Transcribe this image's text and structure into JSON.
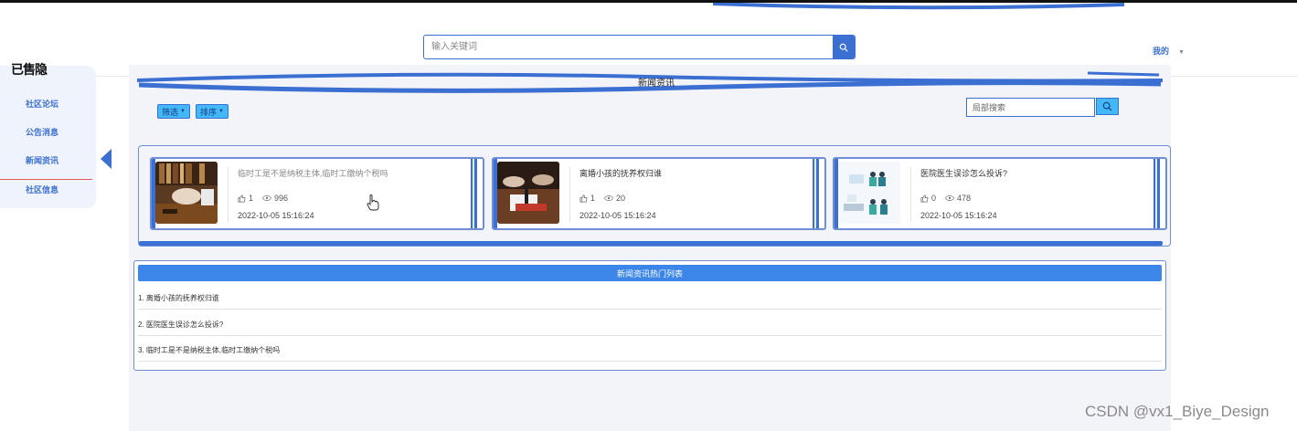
{
  "header": {
    "search_placeholder": "输入关键词",
    "user_menu": "我的",
    "user_menu_caret": "▼"
  },
  "sidebar": {
    "logo": "已售隐",
    "items": [
      {
        "label": "社区论坛"
      },
      {
        "label": "公告消息"
      },
      {
        "label": "新闻资讯",
        "active": true
      },
      {
        "label": "社区信息"
      }
    ]
  },
  "main": {
    "section_title": "新闻资讯",
    "filters": [
      {
        "label": "筛选",
        "caret": "▼"
      },
      {
        "label": "排序",
        "caret": "▼"
      }
    ],
    "local_search_placeholder": "局部搜索",
    "cards": [
      {
        "title": "临时工是不是纳税主体,临时工缴纳个税吗",
        "likes": "1",
        "views": "996",
        "date": "2022-10-05 15:16:24",
        "hovered": true
      },
      {
        "title": "离婚小孩的抚养权归谁",
        "likes": "1",
        "views": "20",
        "date": "2022-10-05 15:16:24"
      },
      {
        "title": "医院医生误诊怎么投诉?",
        "likes": "0",
        "views": "478",
        "date": "2022-10-05 15:16:24"
      }
    ],
    "hot_list": {
      "title": "新闻资讯热门列表",
      "items": [
        "1. 离婚小孩的抚养权归谁",
        "2. 医院医生误诊怎么投诉?",
        "3. 临时工是不是纳税主体,临时工缴纳个税吗"
      ]
    }
  },
  "watermark": "CSDN @vx1_Biye_Design",
  "colors": {
    "accent": "#3b6fd1",
    "button_fill": "#42b8f5",
    "hot_header": "#3b86e8",
    "nav_divider": "#e05a5a"
  }
}
